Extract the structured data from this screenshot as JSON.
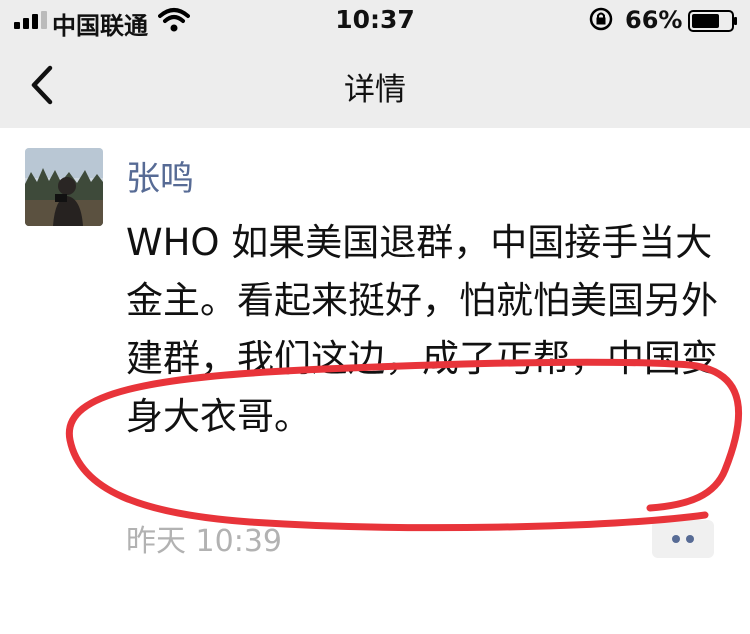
{
  "status_bar": {
    "carrier": "中国联通",
    "time": "10:37",
    "battery": "66%",
    "icons": [
      "signal-icon",
      "wifi-icon",
      "rotation-lock-icon",
      "battery-icon"
    ]
  },
  "nav": {
    "title": "详情",
    "back_icon": "chevron-left-icon"
  },
  "post": {
    "author": "张鸣",
    "text": "WHO 如果美国退群，中国接手当大金主。看起来挺好，怕就怕美国另外建群，我们这边，成了丐帮，中国变身大衣哥。",
    "time": "昨天 10:39",
    "more_icon": "ellipsis-icon"
  },
  "colors": {
    "bar_bg": "#ededed",
    "author": "#576b95",
    "timestamp": "#b2b2b2",
    "annotation": "#e8343a"
  }
}
